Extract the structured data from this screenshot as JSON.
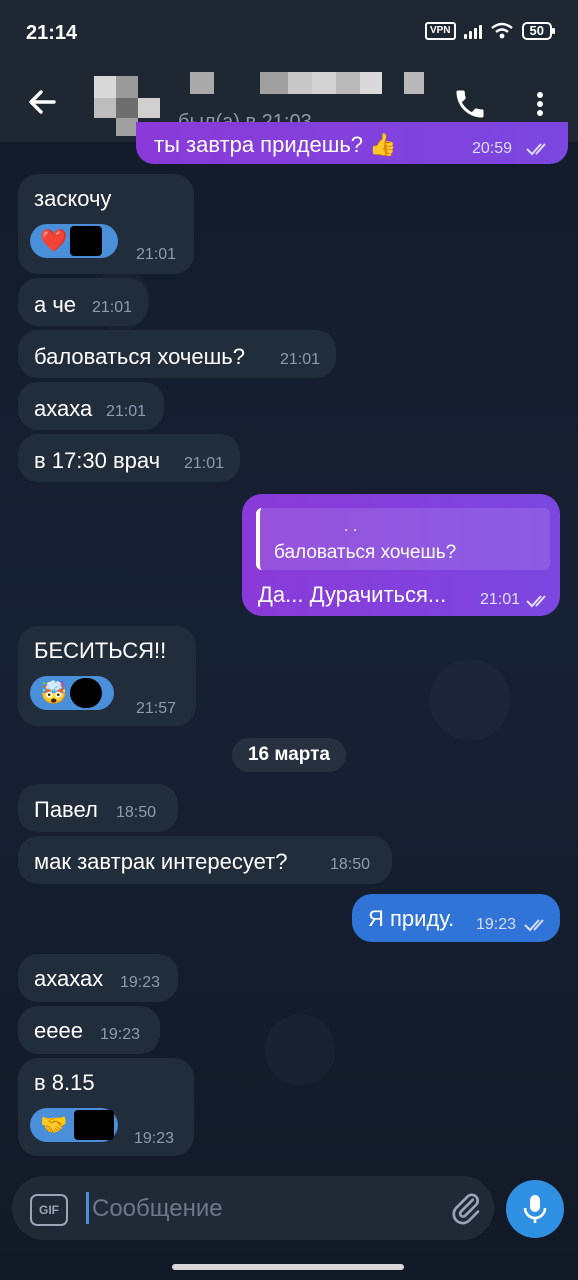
{
  "status_bar": {
    "time": "21:14",
    "vpn": "VPN",
    "battery": "50"
  },
  "header": {
    "last_seen": "был(а) в 21:03"
  },
  "messages": [
    {
      "dir": "out",
      "text": "ты завтра придешь? 👍",
      "time": "20:59",
      "partial": true
    },
    {
      "dir": "in",
      "text": "заскочу",
      "time": "21:01",
      "reaction": "❤️"
    },
    {
      "dir": "in",
      "text": "а че",
      "time": "21:01"
    },
    {
      "dir": "in",
      "text": "баловаться хочешь?",
      "time": "21:01"
    },
    {
      "dir": "in",
      "text": "ахаха",
      "time": "21:01"
    },
    {
      "dir": "in",
      "text": "в 17:30 врач",
      "time": "21:01"
    },
    {
      "dir": "out",
      "reply_author": ". .",
      "reply_text": "баловаться хочешь?",
      "text": "Да... Дурачиться...",
      "time": "21:01"
    },
    {
      "dir": "in",
      "text": "БЕСИТЬСЯ!!",
      "time": "21:57",
      "reaction": "🤯"
    },
    {
      "dir": "in",
      "text": "Павел",
      "time": "18:50"
    },
    {
      "dir": "in",
      "text": "мак завтрак интересует?",
      "time": "18:50"
    },
    {
      "dir": "out",
      "text": "Я приду.",
      "time": "19:23"
    },
    {
      "dir": "in",
      "text": "ахахах",
      "time": "19:23"
    },
    {
      "dir": "in",
      "text": "ееее",
      "time": "19:23"
    },
    {
      "dir": "in",
      "text": "в 8.15",
      "time": "19:23",
      "reaction": "🤝"
    }
  ],
  "date_separator": "16 марта",
  "composer": {
    "placeholder": "Сообщение",
    "gif_label": "GIF"
  },
  "icons": {
    "back": "arrow-left-icon",
    "call": "phone-icon",
    "menu": "more-vertical-icon",
    "attach": "paperclip-icon",
    "mic": "microphone-icon"
  },
  "colors": {
    "outgoing_violet": "#7b47e0",
    "outgoing_blue": "#2f74d6",
    "incoming": "#222d3b",
    "accent": "#2f8fe0"
  }
}
